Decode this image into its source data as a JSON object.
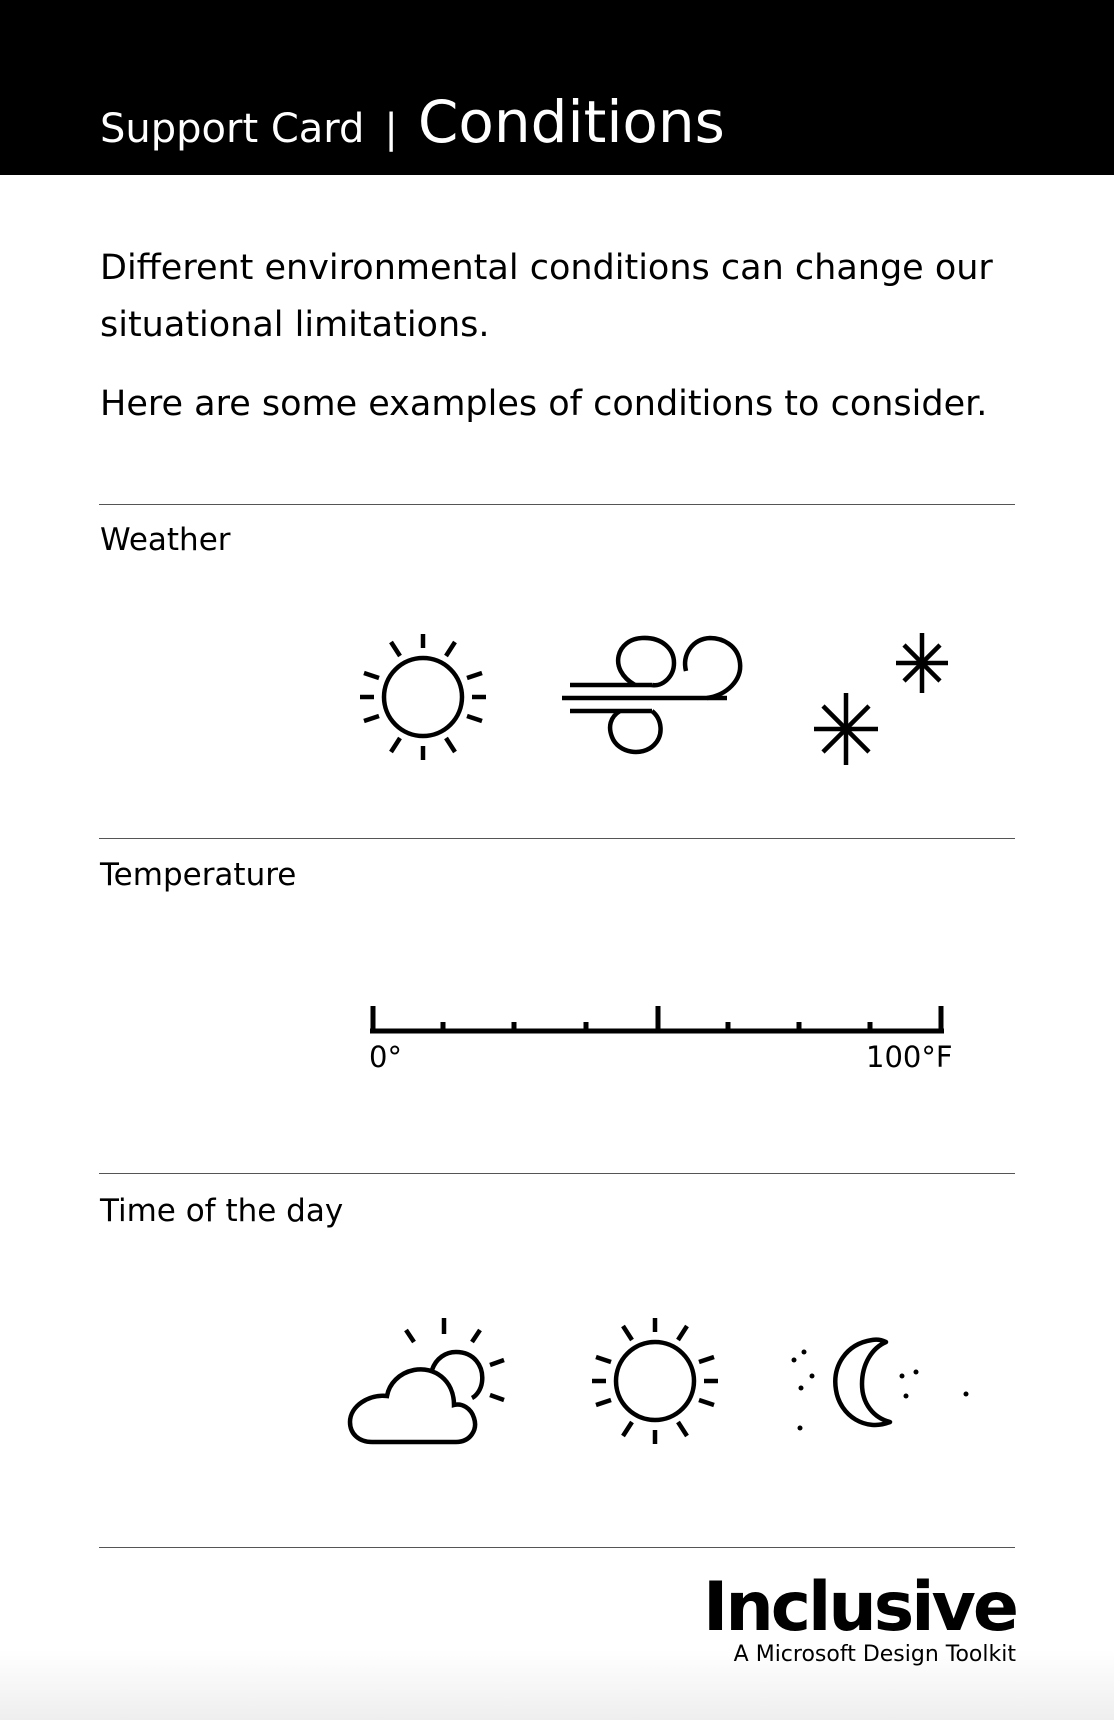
{
  "header": {
    "label": "Support Card",
    "separator": "|",
    "title": "Conditions"
  },
  "intro": {
    "paragraph1": "Different environmental conditions can change our situational limitations.",
    "paragraph2": "Here are some examples of conditions to consider."
  },
  "sections": {
    "weather": {
      "label": "Weather",
      "icons": [
        "sun-icon",
        "wind-icon",
        "snowflakes-icon"
      ]
    },
    "temperature": {
      "label": "Temperature",
      "min_label": "0°",
      "max_label": "100°F"
    },
    "time_of_day": {
      "label": "Time of the day",
      "icons": [
        "partly-cloudy-icon",
        "sun-icon",
        "moon-stars-icon"
      ]
    }
  },
  "logo": {
    "wordmark": "Inclusive",
    "tagline": "A Microsoft Design Toolkit"
  }
}
